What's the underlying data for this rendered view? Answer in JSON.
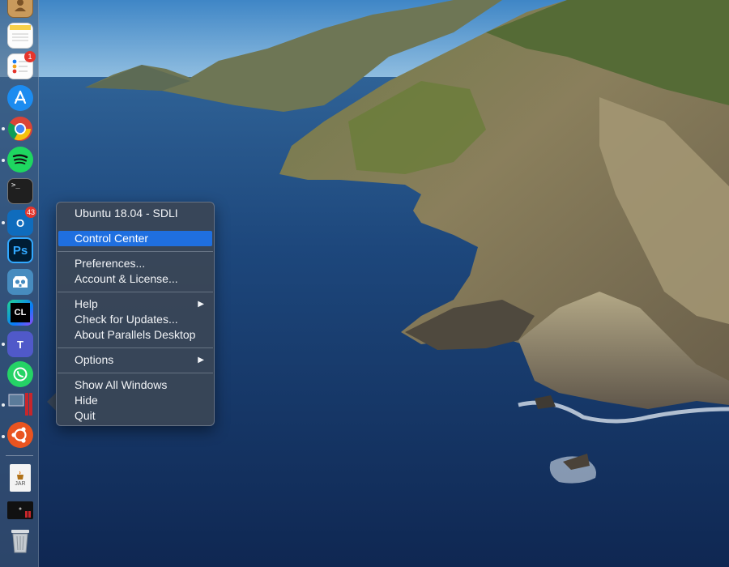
{
  "wallpaper": {
    "name": "macOS Catalina coastline"
  },
  "dock": {
    "items": [
      {
        "name": "contacts-app-icon",
        "running": false
      },
      {
        "name": "notes-app-icon",
        "running": false
      },
      {
        "name": "reminders-app-icon",
        "running": false,
        "badge": "1"
      },
      {
        "name": "app-store-icon",
        "running": false
      },
      {
        "name": "chrome-app-icon",
        "running": true
      },
      {
        "name": "spotify-app-icon",
        "running": true
      },
      {
        "name": "terminal-app-icon",
        "running": false,
        "glyph": ">_"
      },
      {
        "name": "outlook-app-icon",
        "running": true,
        "badge": "43",
        "glyph": "O"
      },
      {
        "name": "photoshop-app-icon",
        "running": false,
        "glyph": "Ps"
      },
      {
        "name": "godot-app-icon",
        "running": false
      },
      {
        "name": "clion-app-icon",
        "running": false,
        "glyph": "CL"
      },
      {
        "name": "teams-app-icon",
        "running": true,
        "glyph": "T"
      },
      {
        "name": "whatsapp-app-icon",
        "running": false
      },
      {
        "name": "parallels-desktop-app-icon",
        "running": true
      },
      {
        "name": "ubuntu-app-icon",
        "running": true
      },
      {
        "name": "jar-file-icon",
        "running": false,
        "label": "JAR"
      },
      {
        "name": "parallels-vm-window-icon",
        "running": false
      },
      {
        "name": "trash-icon",
        "running": false
      }
    ]
  },
  "menu": {
    "items": [
      {
        "label": "Ubuntu 18.04 - SDLI",
        "highlighted": false,
        "submenu": false
      },
      {
        "label": "Control Center",
        "highlighted": true,
        "submenu": false
      },
      {
        "label": "Preferences...",
        "highlighted": false,
        "submenu": false
      },
      {
        "label": "Account & License...",
        "highlighted": false,
        "submenu": false
      },
      {
        "label": "Help",
        "highlighted": false,
        "submenu": true
      },
      {
        "label": "Check for Updates...",
        "highlighted": false,
        "submenu": false
      },
      {
        "label": "About Parallels Desktop",
        "highlighted": false,
        "submenu": false
      },
      {
        "label": "Options",
        "highlighted": false,
        "submenu": true
      },
      {
        "label": "Show All Windows",
        "highlighted": false,
        "submenu": false
      },
      {
        "label": "Hide",
        "highlighted": false,
        "submenu": false
      },
      {
        "label": "Quit",
        "highlighted": false,
        "submenu": false
      }
    ],
    "submenu_arrow": "▶"
  },
  "colors": {
    "highlight": "#1f6fe0",
    "menu_bg": "#3a4656",
    "ocean": "#173a6a"
  }
}
